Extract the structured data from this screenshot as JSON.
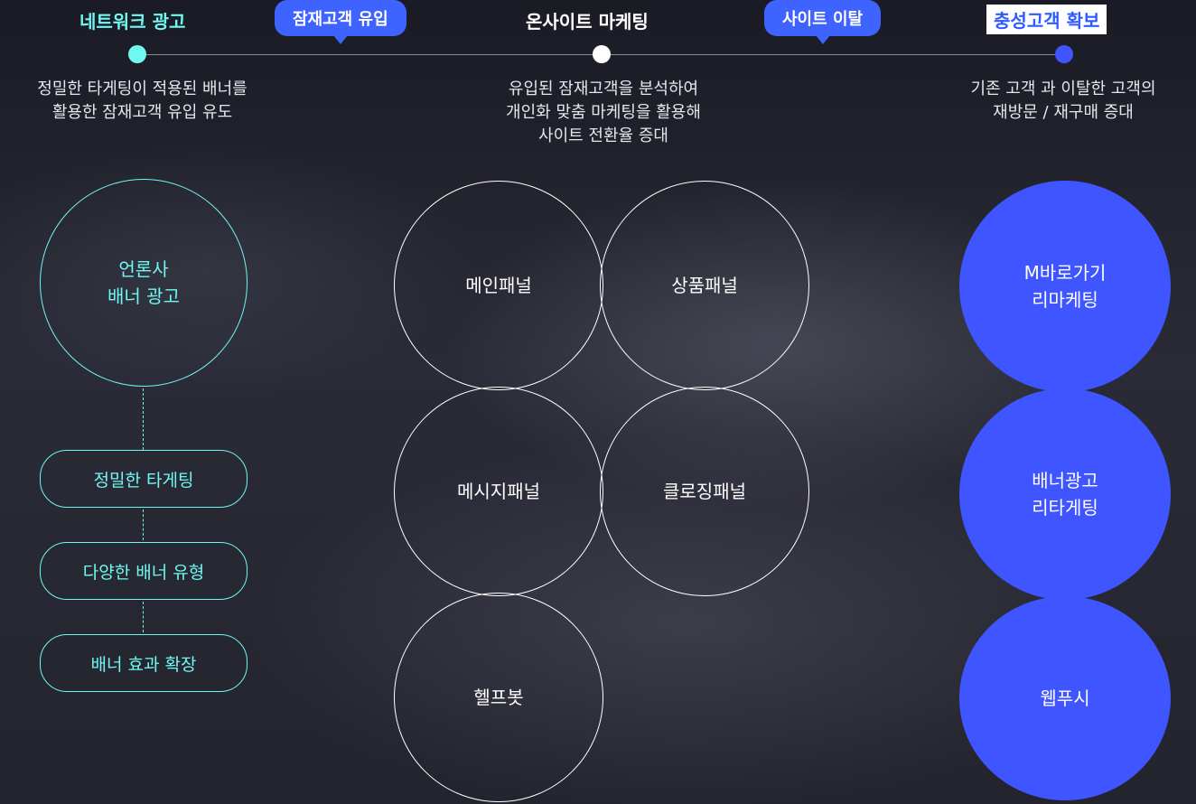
{
  "stages": [
    {
      "label": "네트워크 광고"
    },
    {
      "label": "온사이트 마케팅"
    },
    {
      "label": "충성고객 확보"
    }
  ],
  "bubbles": [
    {
      "label": "잠재고객 유입"
    },
    {
      "label": "사이트 이탈"
    }
  ],
  "descriptions": [
    {
      "text": "정밀한 타게팅이 적용된 배너를\n활용한  잠재고객 유입 유도"
    },
    {
      "text": "유입된 잠재고객을 분석하여\n개인화 맞춤 마케팅을 활용해\n사이트 전환율 증대"
    },
    {
      "text": "기존 고객 과 이탈한 고객의\n재방문 / 재구매 증대"
    }
  ],
  "left": {
    "circle": "언론사\n배너 광고",
    "pills": [
      "정밀한 타게팅",
      "다양한 배너 유형",
      "배너 효과 확장"
    ]
  },
  "middle": {
    "circles": [
      "메인패널",
      "상품패널",
      "메시지패널",
      "클로징패널",
      "헬프봇"
    ]
  },
  "right": {
    "circles": [
      "M바로가기\n리마케팅",
      "배너광고\n리타게팅",
      "웹푸시"
    ]
  },
  "colors": {
    "cyan": "#6ff7f2",
    "blue": "#3f55ff",
    "bubble_blue": "#3f63ff",
    "white": "#ffffff"
  }
}
